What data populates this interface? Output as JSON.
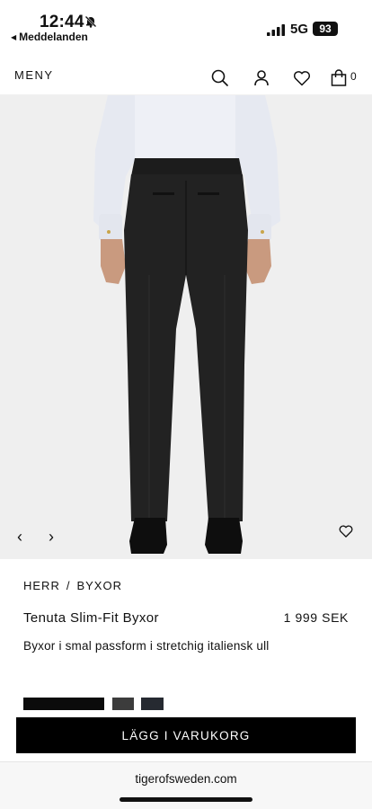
{
  "status_bar": {
    "time": "12:44",
    "back_label": "Meddelanden",
    "network": "5G",
    "battery": "93"
  },
  "header": {
    "menu_label": "MENY",
    "cart_count": "0"
  },
  "product": {
    "breadcrumb": [
      "HERR",
      "BYXOR"
    ],
    "breadcrumb_separator": "/",
    "name": "Tenuta Slim-Fit Byxor",
    "price": "1 999 SEK",
    "description": "Byxor i smal passform i stretchig italiensk ull",
    "swatches": [
      "#0b0b0b",
      "#3c3c3c",
      "#262a31"
    ],
    "add_to_cart_label": "LÄGG I VARUKORG"
  },
  "browser": {
    "url": "tigerofsweden.com"
  }
}
